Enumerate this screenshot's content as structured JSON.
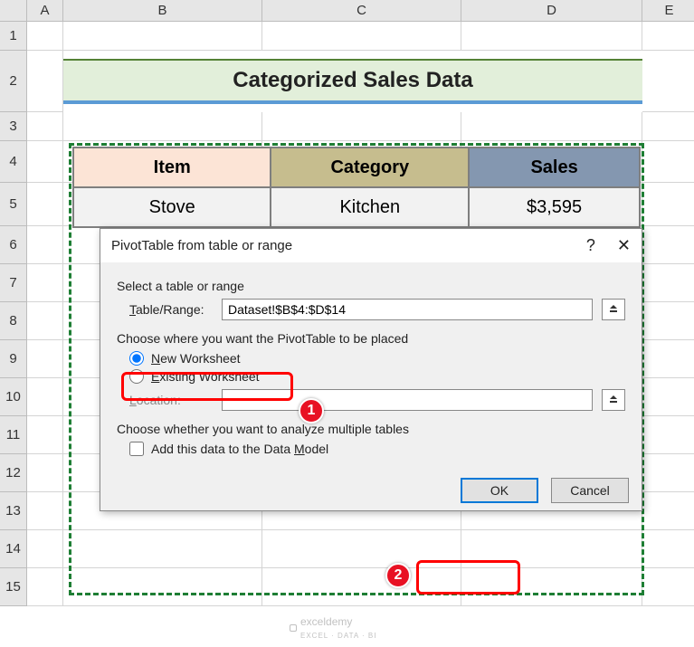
{
  "columns": [
    "A",
    "B",
    "C",
    "D",
    "E"
  ],
  "rows": [
    "1",
    "2",
    "3",
    "4",
    "5",
    "6",
    "7",
    "8",
    "9",
    "10",
    "11",
    "12",
    "13",
    "14",
    "15"
  ],
  "title": "Categorized Sales Data",
  "table": {
    "headers": {
      "item": "Item",
      "category": "Category",
      "sales": "Sales"
    },
    "row1": {
      "item": "Stove",
      "category": "Kitchen",
      "sales": "$3,595"
    }
  },
  "dialog": {
    "title": "PivotTable from table or range",
    "help": "?",
    "close": "✕",
    "sec_select": "Select a table or range",
    "label_tablerange": "Table/Range:",
    "value_tablerange": "Dataset!$B$4:$D$14",
    "sec_place": "Choose where you want the PivotTable to be placed",
    "radio_new": "New Worksheet",
    "radio_existing": "Existing Worksheet",
    "label_location": "Location:",
    "value_location": "",
    "sec_multi": "Choose whether you want to analyze multiple tables",
    "check_model": "Add this data to the Data Model",
    "btn_ok": "OK",
    "btn_cancel": "Cancel"
  },
  "annotations": {
    "b1": "1",
    "b2": "2"
  },
  "watermark": {
    "brand": "exceldemy",
    "tagline": "EXCEL · DATA · BI"
  }
}
